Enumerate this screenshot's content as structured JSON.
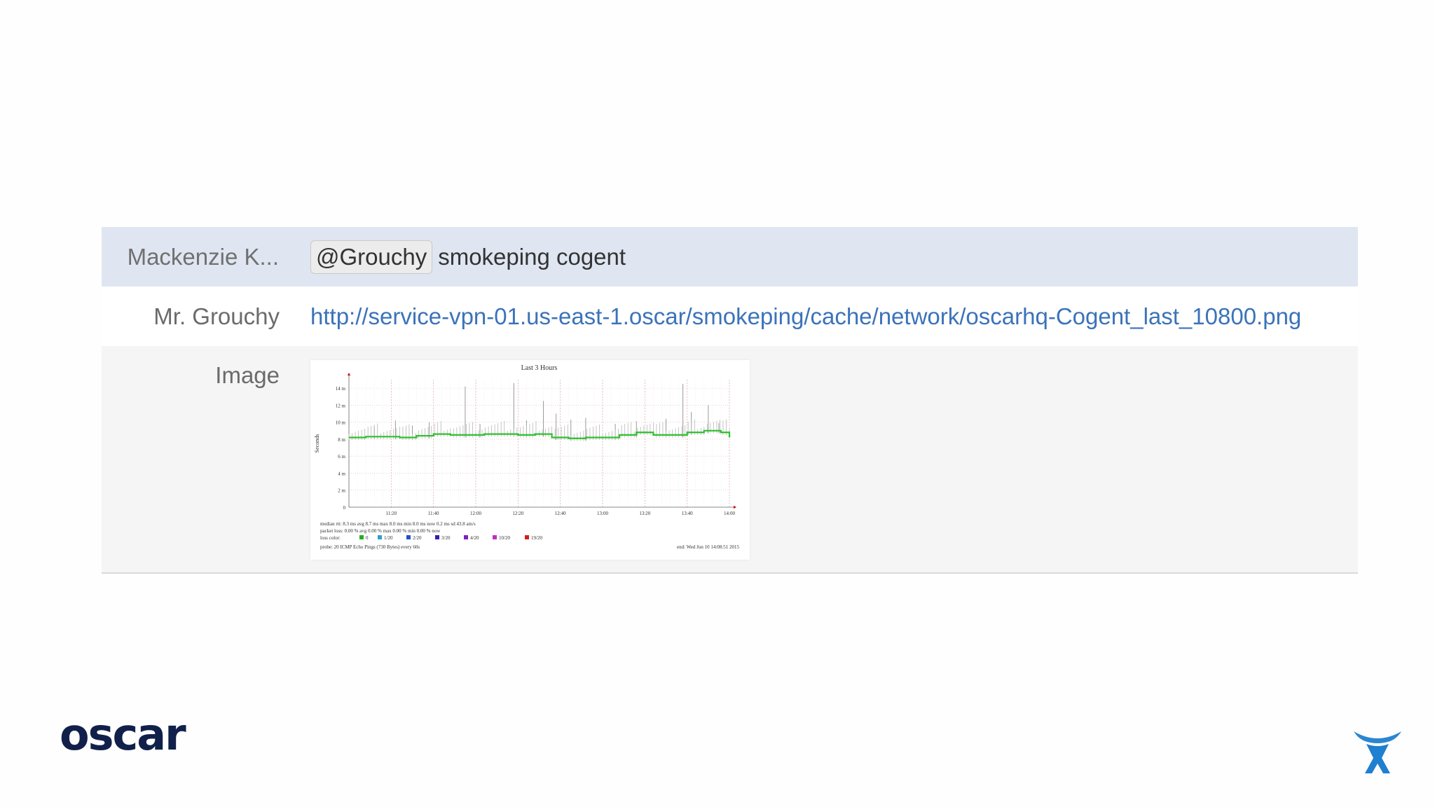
{
  "chat": {
    "messages": [
      {
        "author": "Mackenzie K...",
        "mention": "@Grouchy",
        "text": "smokeping cogent"
      },
      {
        "author": "Mr. Grouchy",
        "link": "http://service-vpn-01.us-east-1.oscar/smokeping/cache/network/oscarhq-Cogent_last_10800.png"
      },
      {
        "author": "Image"
      }
    ]
  },
  "chart_data": {
    "type": "line",
    "title": "Last 3 Hours",
    "ylabel": "Seconds",
    "xlabel": "",
    "y_ticks": [
      "0",
      "2 m",
      "4 m",
      "6 m",
      "8 m",
      "10 m",
      "12 m",
      "14 m"
    ],
    "ylim": [
      0,
      15
    ],
    "x_ticks": [
      "11:20",
      "11:40",
      "12:00",
      "12:20",
      "12:40",
      "13:00",
      "13:20",
      "13:40",
      "14:00"
    ],
    "grid": true,
    "series": [
      {
        "color": "#2fc02f",
        "x": [
          0,
          8,
          16,
          24,
          32,
          40,
          48,
          56,
          64,
          72,
          80,
          88,
          96,
          104,
          112,
          120,
          128,
          136,
          144,
          152,
          160,
          168,
          176,
          180
        ],
        "values": [
          8.2,
          8.3,
          8.3,
          8.2,
          8.4,
          8.6,
          8.5,
          8.5,
          8.6,
          8.6,
          8.5,
          8.6,
          8.2,
          8.1,
          8.2,
          8.2,
          8.5,
          8.8,
          8.5,
          8.5,
          8.8,
          9.0,
          8.8,
          8.2
        ]
      }
    ],
    "spikes_x": [
      12,
      22,
      30,
      38,
      55,
      62,
      78,
      84,
      92,
      98,
      105,
      112,
      126,
      136,
      150,
      158,
      162,
      170,
      175
    ],
    "spikes_y": [
      9.5,
      10.2,
      9.6,
      10.0,
      14.2,
      9.8,
      14.6,
      10.2,
      12.5,
      11.0,
      10.3,
      10.5,
      9.8,
      10.1,
      10.4,
      14.5,
      11.2,
      12.0,
      9.9
    ],
    "legend": [
      {
        "label": "0",
        "color": "#22b022"
      },
      {
        "label": "1/20",
        "color": "#2aa0d0"
      },
      {
        "label": "2/20",
        "color": "#2050d0"
      },
      {
        "label": "3/20",
        "color": "#3020b0"
      },
      {
        "label": "4/20",
        "color": "#8020c0"
      },
      {
        "label": "10/20",
        "color": "#c030c0"
      },
      {
        "label": "19/20",
        "color": "#d02020"
      }
    ],
    "stats_lines": [
      "median rtt:  8.3 ms avg    8.7 ms max    8.0 ms min    8.0 ms now    0.2 ms sd    43.8   am/s",
      "packet loss: 0.00 % avg    0.00 % max    0.00 % min    0.00 % now",
      "loss color:"
    ],
    "probe_text": "probe:      20 ICMP Echo Pings (730 Bytes) every 60s",
    "end_text": "end: Wed Jun 10 14:08:51 2015"
  },
  "logos": {
    "oscar": "oscar",
    "atlassian": "atlassian-icon"
  }
}
